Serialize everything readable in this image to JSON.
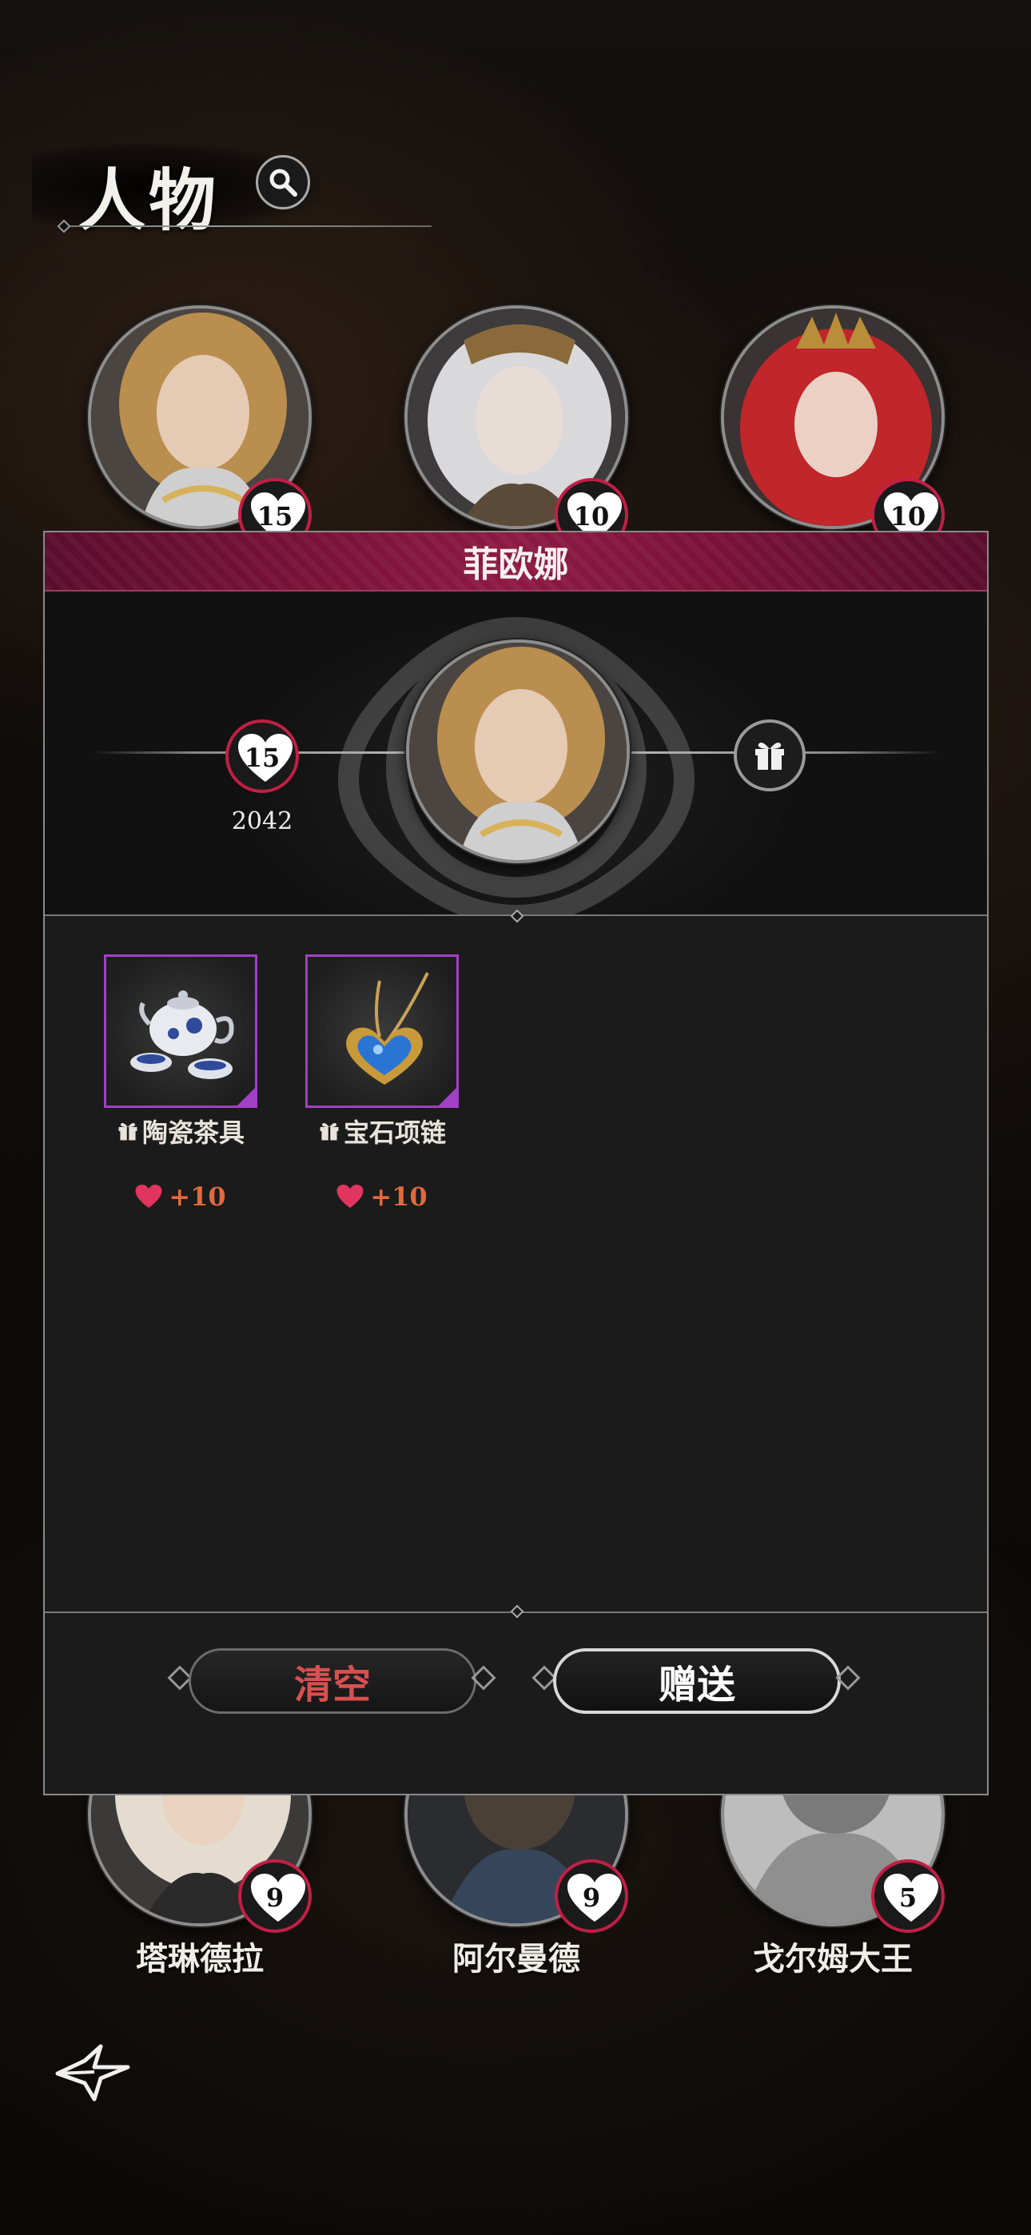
{
  "header": {
    "title": "人物"
  },
  "top_characters": [
    {
      "affinity": "15"
    },
    {
      "affinity": "10"
    },
    {
      "affinity": "10"
    }
  ],
  "bottom_characters": [
    {
      "name": "塔琳德拉",
      "affinity": "9"
    },
    {
      "name": "阿尔曼德",
      "affinity": "9"
    },
    {
      "name": "戈尔姆大王",
      "affinity": "5"
    }
  ],
  "modal": {
    "title": "菲欧娜",
    "affinity_level": "15",
    "affinity_points": "2042",
    "items": [
      {
        "name": "陶瓷茶具",
        "bonus": "+10",
        "icon": "teapot-icon"
      },
      {
        "name": "宝石项链",
        "bonus": "+10",
        "icon": "necklace-icon"
      }
    ],
    "clear_label": "清空",
    "send_label": "赠送"
  },
  "colors": {
    "heart": "#c21f46",
    "title_bar": "#7b1238",
    "item_border": "#a23fc7",
    "bonus_text": "#e06a3d",
    "clear_text": "#d85050"
  }
}
